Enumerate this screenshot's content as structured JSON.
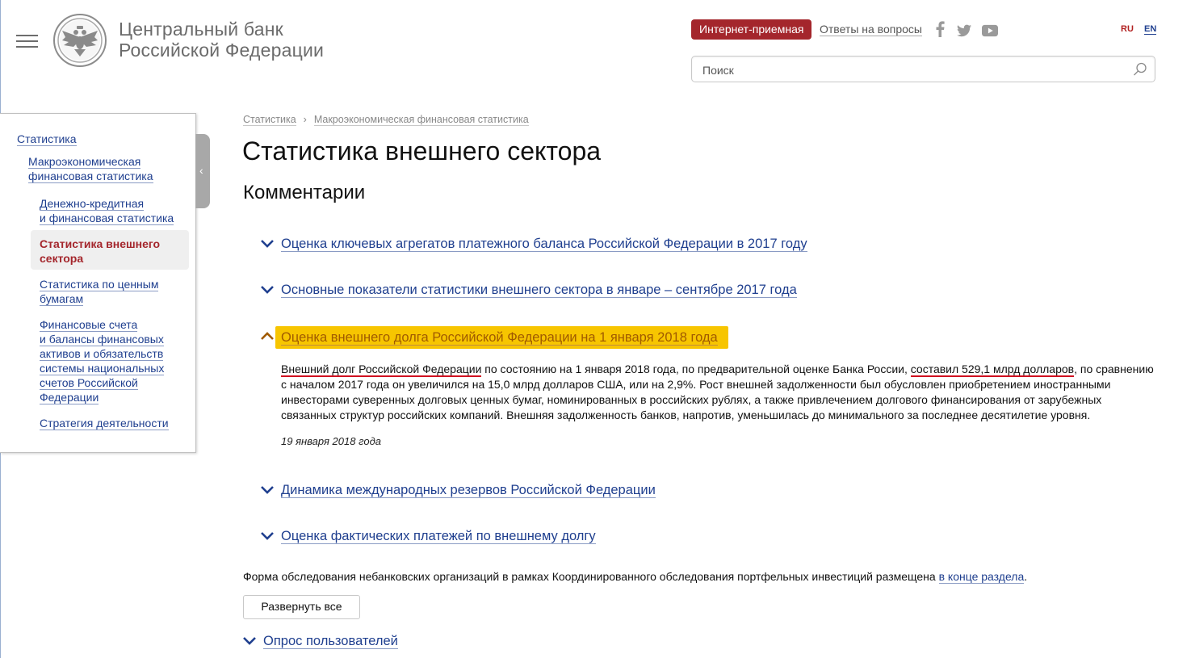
{
  "header": {
    "bank_name_line1": "Центральный банк",
    "bank_name_line2": "Российской Федерации",
    "reception_button": "Интернет-приемная",
    "faq_link": "Ответы на вопросы",
    "social_icons": [
      "facebook-icon",
      "twitter-icon",
      "youtube-icon"
    ],
    "lang_ru": "RU",
    "lang_en": "EN",
    "accent_color": "#a4262c",
    "link_color": "#1f3f8f"
  },
  "search": {
    "placeholder": "Поиск"
  },
  "sidebar": {
    "items": [
      {
        "label": "Статистика"
      },
      {
        "label_line1": "Макроэкономическая",
        "label_line2": "финансовая статистика"
      },
      {
        "label_line1": "Денежно-кредитная",
        "label_line2": "и финансовая статистика"
      },
      {
        "label_line1": "Статистика внешнего",
        "label_line2": "сектора",
        "active": true
      },
      {
        "label_line1": "Статистика по ценным",
        "label_line2": "бумагам"
      },
      {
        "lines": [
          "Финансовые счета",
          "и балансы финансовых",
          "активов и обязательств",
          "системы национальных",
          "счетов Российской",
          "Федерации"
        ]
      },
      {
        "label": "Стратегия деятельности"
      }
    ]
  },
  "breadcrumb": [
    "Статистика",
    "Макроэкономическая финансовая статистика"
  ],
  "page_title": "Статистика внешнего сектора",
  "section_title": "Комментарии",
  "accordion": [
    {
      "title": "Оценка ключевых агрегатов платежного баланса Российской Федерации в 2017 году",
      "open": false
    },
    {
      "title": "Основные показатели статистики внешнего сектора в январе – сентябре 2017 года",
      "open": false
    },
    {
      "title": "Оценка внешнего долга Российской Федерации на 1 января 2018 года",
      "open": true,
      "highlight_color": "#f7c500",
      "body": {
        "part1": "Внешний долг Российской Федерации",
        "part2": " по состоянию на 1 января 2018 года, по предварительной оценке Банка России, ",
        "part3": "составил 529,1 млрд долларов",
        "part4": ", по сравнению с началом 2017 года он увеличился на 15,0 млрд долларов США, или на 2,9%. Рост внешней задолженности был обусловлен приобретением иностранными инвесторами суверенных долговых ценных бумаг, номинированных в российских рублях, а также привлечением долгового финансирования от зарубежных связанных структур российских компаний. Внешняя задолженность банков, напротив, уменьшилась до минимального за последнее десятилетие уровня.",
        "underline_color": "#d01020",
        "date": "19 января 2018 года"
      }
    },
    {
      "title": "Динамика международных резервов Российской Федерации",
      "open": false
    },
    {
      "title": "Оценка фактических платежей по внешнему долгу",
      "open": false
    }
  ],
  "form_note": {
    "text": "Форма обследования небанковских организаций в рамках Координированного обследования портфельных инвестиций размещена ",
    "link": "в конце раздела",
    "end": "."
  },
  "expand_button": "Развернуть все",
  "survey": {
    "title": "Опрос пользователей"
  }
}
